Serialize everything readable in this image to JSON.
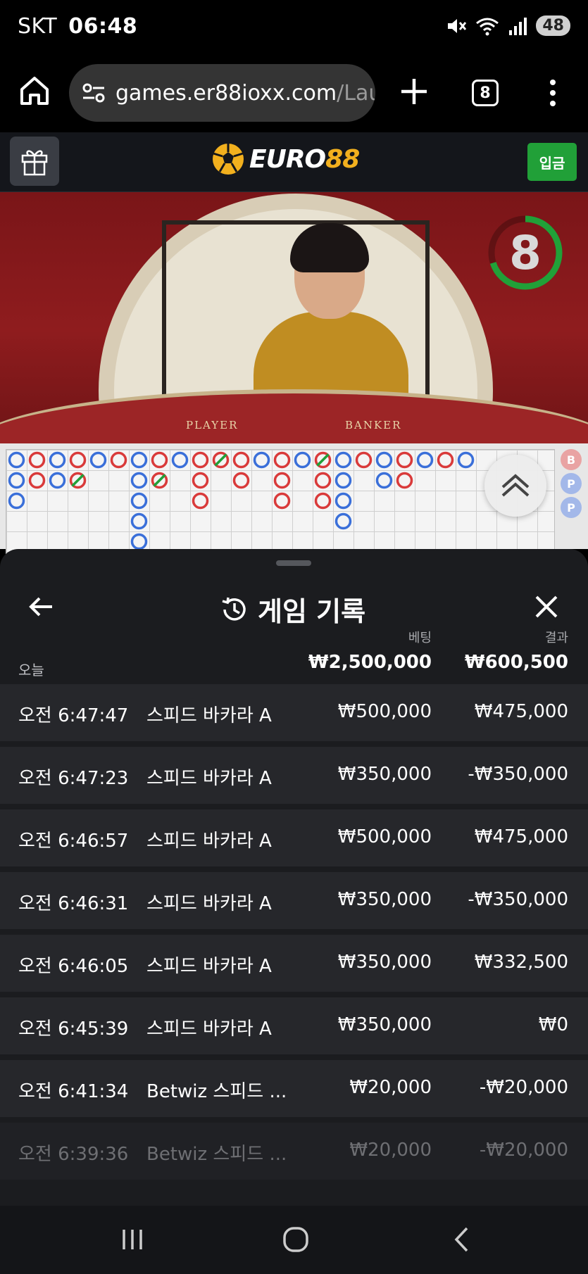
{
  "status_bar": {
    "carrier": "SKT",
    "time": "06:48",
    "battery": "48",
    "icons": [
      "mute-icon",
      "wifi-icon",
      "signal-icon",
      "battery-icon"
    ]
  },
  "browser": {
    "url_host": "games.er88ioxx.com",
    "url_path": "/Launc",
    "tab_count": "8"
  },
  "site_header": {
    "logo_part1": "EURO",
    "logo_part2": "88",
    "deposit_label": "입금"
  },
  "video": {
    "timer": "8",
    "timer_fraction": 0.7,
    "label_player": "PLAYER",
    "label_banker": "BANKER"
  },
  "roadmap": {
    "side_chips": [
      "B",
      "P",
      "P"
    ]
  },
  "history": {
    "title": "게임 기록",
    "col_bet": "베팅",
    "col_result": "결과",
    "today_label": "오늘",
    "total_bet": "₩2,500,000",
    "total_result": "₩600,500",
    "rows": [
      {
        "time": "오전 6:47:47",
        "game": "스피드 바카라 A",
        "bet": "₩500,000",
        "result": "₩475,000"
      },
      {
        "time": "오전 6:47:23",
        "game": "스피드 바카라 A",
        "bet": "₩350,000",
        "result": "-₩350,000"
      },
      {
        "time": "오전 6:46:57",
        "game": "스피드 바카라 A",
        "bet": "₩500,000",
        "result": "₩475,000"
      },
      {
        "time": "오전 6:46:31",
        "game": "스피드 바카라 A",
        "bet": "₩350,000",
        "result": "-₩350,000"
      },
      {
        "time": "오전 6:46:05",
        "game": "스피드 바카라 A",
        "bet": "₩350,000",
        "result": "₩332,500"
      },
      {
        "time": "오전 6:45:39",
        "game": "스피드 바카라 A",
        "bet": "₩350,000",
        "result": "₩0"
      },
      {
        "time": "오전 6:41:34",
        "game": "Betwiz 스피드 ...",
        "bet": "₩20,000",
        "result": "-₩20,000"
      },
      {
        "time": "오전 6:39:36",
        "game": "Betwiz 스피드 ...",
        "bet": "₩20,000",
        "result": "-₩20,000"
      }
    ]
  },
  "colors": {
    "accent_green": "#21a038",
    "logo_yellow": "#f2b01e",
    "panel_bg": "#1b1c1f",
    "row_bg": "#26272b",
    "banker_red": "#d93a3a",
    "player_blue": "#3a6fd9"
  }
}
